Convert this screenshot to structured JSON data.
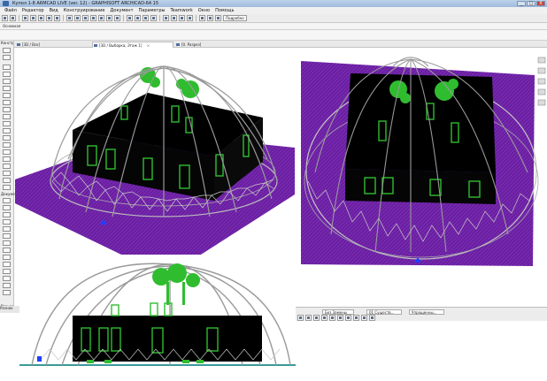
{
  "window": {
    "title": "Купол 1-8 ARMCAD LIVE (ver. 12) - GRAPHISOFT ARCHICAD-64 15",
    "buttons": [
      "_",
      "□",
      "X"
    ]
  },
  "menu": [
    "Файл",
    "Редактор",
    "Вид",
    "Конструирование",
    "Документ",
    "Параметры",
    "Teamwork",
    "Окно",
    "Помощь"
  ],
  "toolbar": {
    "layer_select": "Подробно",
    "scale_select": "",
    "info_label": "Основная"
  },
  "tabs": [
    {
      "label": "[3D / Все]"
    },
    {
      "label": "[3D / Выборка, Этаж 1]"
    },
    {
      "label": "[0. Разрез]"
    }
  ],
  "toolbox": {
    "header_design": "Конструирование",
    "header_docs": "Документирование",
    "header_more": "Разное"
  },
  "status_bar": {
    "items": [
      "Без Замены",
      "01 Существ...",
      "Упрощенны..."
    ]
  },
  "colors": {
    "ground": "#6a1fa0",
    "building": "#000000",
    "trim": "#2fbd2f",
    "dome": "#9a9a9a",
    "tree": "#2fbd2f"
  }
}
